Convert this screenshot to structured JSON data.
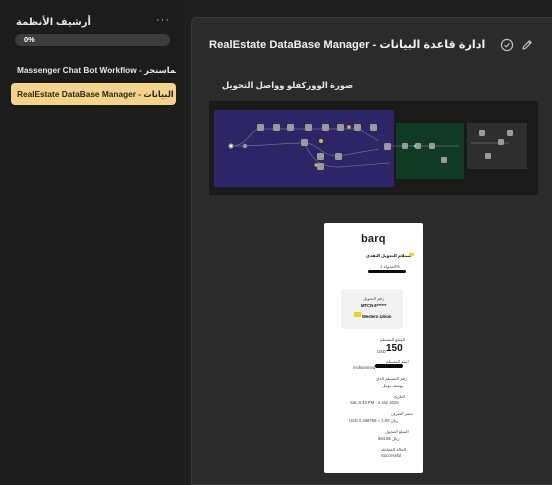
{
  "sidebar": {
    "title": "أرشيف الأنظمة",
    "more_icon": "more-horizontal-icon",
    "progress": {
      "label": "0%",
      "value": 0
    },
    "items": [
      {
        "label": "Massenger Chat Bot Workflow - بوت للماسنجر",
        "active": false
      },
      {
        "label": "RealEstate DataBase Manager - ادارة قاعدة البيانات",
        "active": true
      }
    ]
  },
  "main": {
    "title": "RealEstate DataBase Manager - ادارة قاعدة البيانات",
    "section_label": "صورة الووركفلو وواصل التحويل",
    "actions": [
      {
        "name": "check-circle-icon"
      },
      {
        "name": "pencil-icon"
      }
    ]
  },
  "receipt": {
    "logo": "barq",
    "heading": "استلام التحويل النقدي",
    "sub_heading": "العمولة 1%",
    "transfer_id_label": "رقم التحويل",
    "transfer_id": "MTCN 6******",
    "partner": "Western Union",
    "amount_label": "المبلغ المستلم",
    "currency": "USD",
    "amount": "150",
    "receiver_label": "اسم المستلم",
    "receiver": "mohammed",
    "sender_label": "رقم المستلم الذي",
    "sender": "يوسف بوتيل",
    "date_label": "التاريخ",
    "date": "Sat, 8:43 PM · 4 Jan 2025",
    "rate_label": "سعر الصرف",
    "rate": "USD 0.266759 = ريال 1.00",
    "fee_label": "المبلغ المحول",
    "fee": "ريال 564.85",
    "status_label": "الحالة المعاملة",
    "status": "Successful"
  },
  "colors": {
    "active_item_bg": "#f4d48a",
    "panel_bg": "#2b2b2b",
    "sidebar_bg": "#1c1c1c",
    "wf_purple": "#2d2566",
    "wf_green": "#0f3a25",
    "wf_gray": "#2e2e2e"
  }
}
